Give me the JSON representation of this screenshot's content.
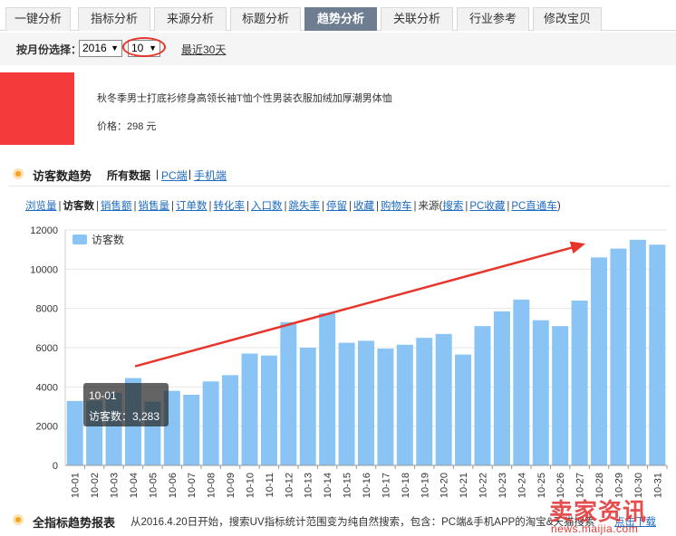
{
  "tabs": [
    {
      "label": "一键分析",
      "active": false
    },
    {
      "label": "指标分析",
      "active": false
    },
    {
      "label": "来源分析",
      "active": false
    },
    {
      "label": "标题分析",
      "active": false
    },
    {
      "label": "趋势分析",
      "active": true
    },
    {
      "label": "关联分析",
      "active": false
    },
    {
      "label": "行业参考",
      "active": false
    },
    {
      "label": "修改宝贝",
      "active": false
    }
  ],
  "month_bar": {
    "label": "按月份选择：",
    "year_value": "2016",
    "month_value": "10",
    "recent_link": "最近30天"
  },
  "product": {
    "title": "秋冬季男士打底衫修身高领长袖T恤个性男装衣服加绒加厚潮男体恤",
    "price": "价格：298 元"
  },
  "section": {
    "title": "访客数趋势",
    "filter_all": "所有数据",
    "filter_pc": "PC端",
    "filter_mobile": "手机端"
  },
  "metric_links": {
    "items": [
      "浏览量",
      "访客数",
      "销售额",
      "销售量",
      "订单数",
      "转化率",
      "入口数",
      "跳失率",
      "停留",
      "收藏",
      "购物车"
    ],
    "active": "访客数",
    "source_prefix": "来源(",
    "source_items": [
      "搜索",
      "PC收藏",
      "PC直通车"
    ],
    "source_suffix": ")"
  },
  "tooltip": {
    "date": "10-01",
    "text": "访客数：3,283"
  },
  "chart_data": {
    "type": "bar",
    "legend": [
      "访客数"
    ],
    "legend_position": "top-left",
    "categories": [
      "10-01",
      "10-02",
      "10-03",
      "10-04",
      "10-05",
      "10-06",
      "10-07",
      "10-08",
      "10-09",
      "10-10",
      "10-11",
      "10-12",
      "10-13",
      "10-14",
      "10-15",
      "10-16",
      "10-17",
      "10-18",
      "10-19",
      "10-20",
      "10-21",
      "10-22",
      "10-23",
      "10-24",
      "10-25",
      "10-26",
      "10-27",
      "10-28",
      "10-29",
      "10-30",
      "10-31"
    ],
    "series": [
      {
        "name": "访客数",
        "values": [
          3283,
          3300,
          3700,
          4450,
          3250,
          3800,
          3600,
          4280,
          4600,
          5700,
          5600,
          7300,
          6000,
          7750,
          6250,
          6350,
          5950,
          6150,
          6500,
          6700,
          5650,
          7100,
          7850,
          8450,
          7400,
          7100,
          8400,
          10600,
          11050,
          11500,
          11250
        ],
        "color": "#89c4f4"
      }
    ],
    "ylim": [
      0,
      12000
    ],
    "yticks": [
      0,
      2000,
      4000,
      6000,
      8000,
      10000,
      12000
    ],
    "grid": true,
    "annotation": "red trend arrow from 10-04 up to 10-28"
  },
  "bottom": {
    "title": "全指标趋势报表",
    "note": "从2016.4.20日开始，搜索UV指标统计范围变为纯自然搜索，包含：PC端&手机APP的淘宝&天猫搜索",
    "download": "点击下载"
  },
  "watermark": {
    "cn": "卖家资讯",
    "url": "news.maijia.com"
  },
  "colors": {
    "tab_active": "#6e7d8f",
    "bar": "#89c4f4",
    "accent_red": "#e8352c",
    "link": "#1e6bbf",
    "orange": "#f7a21b"
  }
}
